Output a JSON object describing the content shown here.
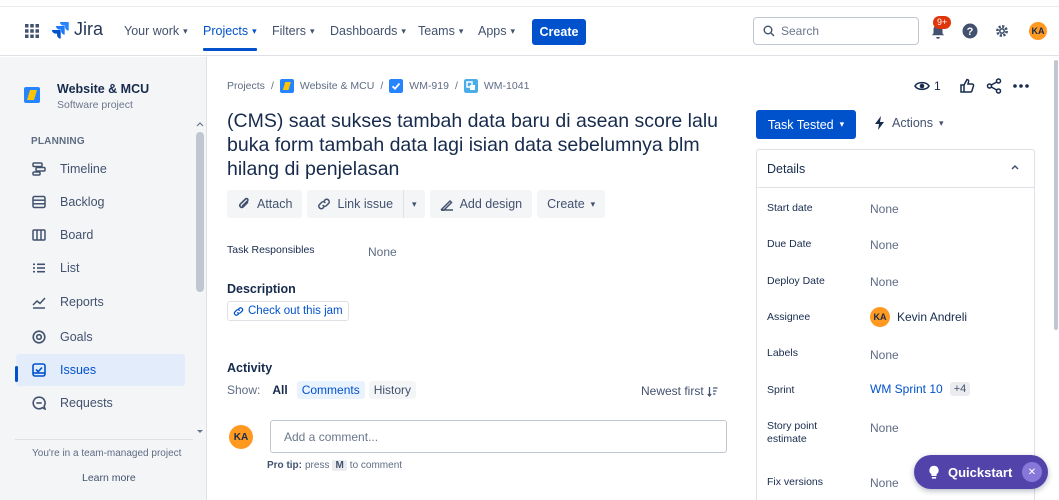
{
  "topnav": {
    "logo_text": "Jira",
    "items": [
      {
        "label": "Your work"
      },
      {
        "label": "Projects"
      },
      {
        "label": "Filters"
      },
      {
        "label": "Dashboards"
      },
      {
        "label": "Teams"
      },
      {
        "label": "Apps"
      }
    ],
    "create_label": "Create",
    "search_placeholder": "Search",
    "notifications_badge": "9+",
    "user_initials": "KA"
  },
  "sidebar": {
    "project_name": "Website & MCU",
    "project_type": "Software project",
    "section_label": "PLANNING",
    "items": [
      {
        "label": "Timeline",
        "icon": "timeline-icon"
      },
      {
        "label": "Backlog",
        "icon": "backlog-icon"
      },
      {
        "label": "Board",
        "icon": "board-icon"
      },
      {
        "label": "List",
        "icon": "list-icon"
      },
      {
        "label": "Reports",
        "icon": "reports-icon"
      },
      {
        "label": "Goals",
        "icon": "goals-icon"
      },
      {
        "label": "Issues",
        "icon": "issues-icon",
        "active": true
      },
      {
        "label": "Requests",
        "icon": "requests-icon"
      }
    ],
    "team_managed_text": "You're in a team-managed project",
    "learn_more": "Learn more"
  },
  "breadcrumb": {
    "projects": "Projects",
    "project": "Website & MCU",
    "parent": "WM-919",
    "issue": "WM-1041",
    "sep": "/"
  },
  "issue": {
    "title": "(CMS) saat sukses tambah data baru di asean score lalu buka form tambah data lagi isian data sebelumnya blm hilang di penjelasan",
    "watchers": "1"
  },
  "toolbar": {
    "attach": "Attach",
    "link_issue": "Link issue",
    "add_design": "Add design",
    "create": "Create"
  },
  "fields": {
    "task_responsibles_label": "Task Responsibles",
    "task_responsibles_value": "None",
    "description_label": "Description",
    "jam_link": "Check out this jam"
  },
  "activity": {
    "label": "Activity",
    "show_label": "Show:",
    "filters": [
      "All",
      "Comments",
      "History"
    ],
    "sort_label": "Newest first",
    "comment_placeholder": "Add a comment...",
    "protip_prefix": "Pro tip:",
    "protip_press": "press",
    "protip_key": "M",
    "protip_suffix": "to comment",
    "user_initials": "KA"
  },
  "right_panel": {
    "status": "Task Tested",
    "actions": "Actions",
    "details_title": "Details",
    "details": [
      {
        "label": "Start date",
        "value": "None"
      },
      {
        "label": "Due Date",
        "value": "None"
      },
      {
        "label": "Deploy Date",
        "value": "None"
      },
      {
        "label": "Assignee",
        "value": "Kevin Andreli",
        "avatar": "KA"
      },
      {
        "label": "Labels",
        "value": "None"
      },
      {
        "label": "Sprint",
        "value": "WM Sprint 10",
        "extra": "+4"
      },
      {
        "label": "Story point estimate",
        "value": "None"
      },
      {
        "label": "Fix versions",
        "value": "None"
      }
    ]
  },
  "quickstart": {
    "label": "Quickstart"
  },
  "colors": {
    "primary": "#0052cc",
    "quickstart": "#5243aa",
    "avatar": "#ff991f",
    "badge": "#de350b"
  }
}
